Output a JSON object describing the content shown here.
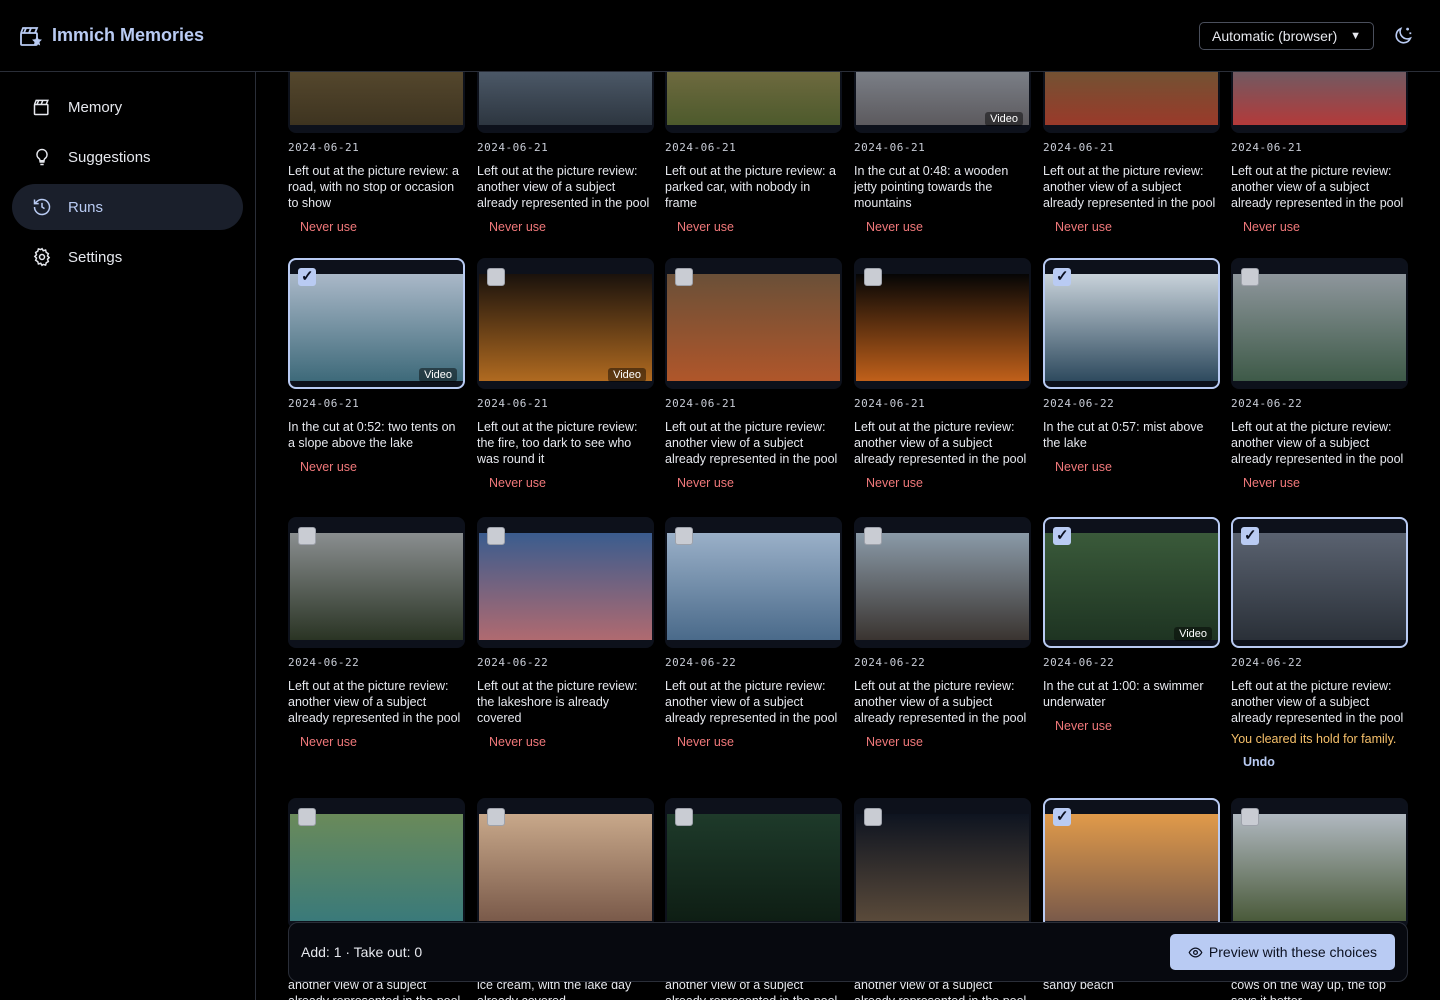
{
  "app": {
    "title": "Immich Memories"
  },
  "header": {
    "theme_select_value": "Automatic (browser)"
  },
  "sidebar": {
    "items": [
      {
        "label": "Memory",
        "icon": "clapperboard-icon",
        "active": false
      },
      {
        "label": "Suggestions",
        "icon": "lightbulb-icon",
        "active": false
      },
      {
        "label": "Runs",
        "icon": "history-icon",
        "active": true
      },
      {
        "label": "Settings",
        "icon": "gear-icon",
        "active": false
      }
    ]
  },
  "cards": [
    {
      "date": "2024-06-21",
      "desc": "Left out at the picture review: a road, with no stop or occasion to show",
      "action": "Never use",
      "checked": false,
      "video": false,
      "colors": [
        "#6b5a3a",
        "#3e3420"
      ]
    },
    {
      "date": "2024-06-21",
      "desc": "Left out at the picture review: another view of a subject already represented in the pool",
      "action": "Never use",
      "checked": false,
      "video": false,
      "colors": [
        "#6a7a8e",
        "#2d3640"
      ]
    },
    {
      "date": "2024-06-21",
      "desc": "Left out at the picture review: a parked car, with nobody in frame",
      "action": "Never use",
      "checked": false,
      "video": false,
      "colors": [
        "#8f7a52",
        "#4d5a2c"
      ]
    },
    {
      "date": "2024-06-21",
      "desc": "In the cut at 0:48: a wooden jetty pointing towards the mountains",
      "action": "Never use",
      "checked": false,
      "video": true,
      "video_label": "Video",
      "colors": [
        "#9aa4b0",
        "#5c5a5e"
      ]
    },
    {
      "date": "2024-06-21",
      "desc": "Left out at the picture review: another view of a subject already represented in the pool",
      "action": "Never use",
      "checked": false,
      "video": false,
      "colors": [
        "#4b6a3c",
        "#9a3a2a"
      ]
    },
    {
      "date": "2024-06-21",
      "desc": "Left out at the picture review: another view of a subject already represented in the pool",
      "action": "Never use",
      "checked": false,
      "video": false,
      "colors": [
        "#2f7a8a",
        "#b33a3a"
      ]
    },
    {
      "date": "2024-06-21",
      "desc": "In the cut at 0:52: two tents on a slope above the lake",
      "action": "Never use",
      "checked": true,
      "video": true,
      "video_label": "Video",
      "colors": [
        "#aab8c8",
        "#3e6a7a"
      ]
    },
    {
      "date": "2024-06-21",
      "desc": "Left out at the picture review: the fire, too dark to see who was round it",
      "action": "Never use",
      "checked": false,
      "video": true,
      "video_label": "Video",
      "colors": [
        "#1a120c",
        "#b06a20"
      ]
    },
    {
      "date": "2024-06-21",
      "desc": "Left out at the picture review: another view of a subject already represented in the pool",
      "action": "Never use",
      "checked": false,
      "video": false,
      "colors": [
        "#6a5038",
        "#b0562a"
      ]
    },
    {
      "date": "2024-06-21",
      "desc": "Left out at the picture review: another view of a subject already represented in the pool",
      "action": "Never use",
      "checked": false,
      "video": false,
      "colors": [
        "#050505",
        "#c0601a"
      ]
    },
    {
      "date": "2024-06-22",
      "desc": "In the cut at 0:57: mist above the lake",
      "action": "Never use",
      "checked": true,
      "video": false,
      "colors": [
        "#c8d2da",
        "#2e4a5e"
      ]
    },
    {
      "date": "2024-06-22",
      "desc": "Left out at the picture review: another view of a subject already represented in the pool",
      "action": "Never use",
      "checked": false,
      "video": false,
      "colors": [
        "#8e969c",
        "#3e5a48"
      ]
    },
    {
      "date": "2024-06-22",
      "desc": "Left out at the picture review: another view of a subject already represented in the pool",
      "action": "Never use",
      "checked": false,
      "video": false,
      "colors": [
        "#8a8e90",
        "#2a3424"
      ]
    },
    {
      "date": "2024-06-22",
      "desc": "Left out at the picture review: the lakeshore is already covered",
      "action": "Never use",
      "checked": false,
      "video": false,
      "colors": [
        "#3a5c8e",
        "#b06a70"
      ]
    },
    {
      "date": "2024-06-22",
      "desc": "Left out at the picture review: another view of a subject already represented in the pool",
      "action": "Never use",
      "checked": false,
      "video": false,
      "colors": [
        "#9ab0c8",
        "#4a6a8a"
      ]
    },
    {
      "date": "2024-06-22",
      "desc": "Left out at the picture review: another view of a subject already represented in the pool",
      "action": "Never use",
      "checked": false,
      "video": false,
      "colors": [
        "#8a9aa8",
        "#3a3430"
      ]
    },
    {
      "date": "2024-06-22",
      "desc": "In the cut at 1:00: a swimmer underwater",
      "action": "Never use",
      "checked": true,
      "video": true,
      "video_label": "Video",
      "colors": [
        "#3a5a3a",
        "#1e3422"
      ]
    },
    {
      "date": "2024-06-22",
      "desc": "Left out at the picture review: another view of a subject already represented in the pool",
      "action": "",
      "checked": true,
      "video": false,
      "hold_note": "You cleared its hold for family.",
      "undo": "Undo",
      "colors": [
        "#5a6270",
        "#2a3038"
      ]
    },
    {
      "date": "",
      "desc": "another view of a subject already represented in the pool",
      "action": "",
      "checked": false,
      "video": false,
      "colors": [
        "#6a8a5a",
        "#3a7a7a"
      ]
    },
    {
      "date": "",
      "desc": "ice cream, with the lake day already covered",
      "action": "",
      "checked": false,
      "video": false,
      "colors": [
        "#c8a88a",
        "#7a5a4a"
      ]
    },
    {
      "date": "",
      "desc": "another view of a subject already represented in the pool",
      "action": "",
      "checked": false,
      "video": false,
      "colors": [
        "#1e3a2a",
        "#0e1e14"
      ]
    },
    {
      "date": "",
      "desc": "another view of a subject already represented in the pool",
      "action": "",
      "checked": false,
      "video": false,
      "colors": [
        "#0e1420",
        "#5a4a3a"
      ]
    },
    {
      "date": "",
      "desc": "sandy beach",
      "action": "",
      "checked": true,
      "video": false,
      "colors": [
        "#e09a4a",
        "#7a5a4a"
      ]
    },
    {
      "date": "",
      "desc": "cows on the way up, the top says it better",
      "action": "",
      "checked": false,
      "video": false,
      "colors": [
        "#b0b8c0",
        "#4a5a3a"
      ]
    }
  ],
  "footer": {
    "counts": "Add: 1 · Take out: 0",
    "preview_label": "Preview with these choices"
  }
}
